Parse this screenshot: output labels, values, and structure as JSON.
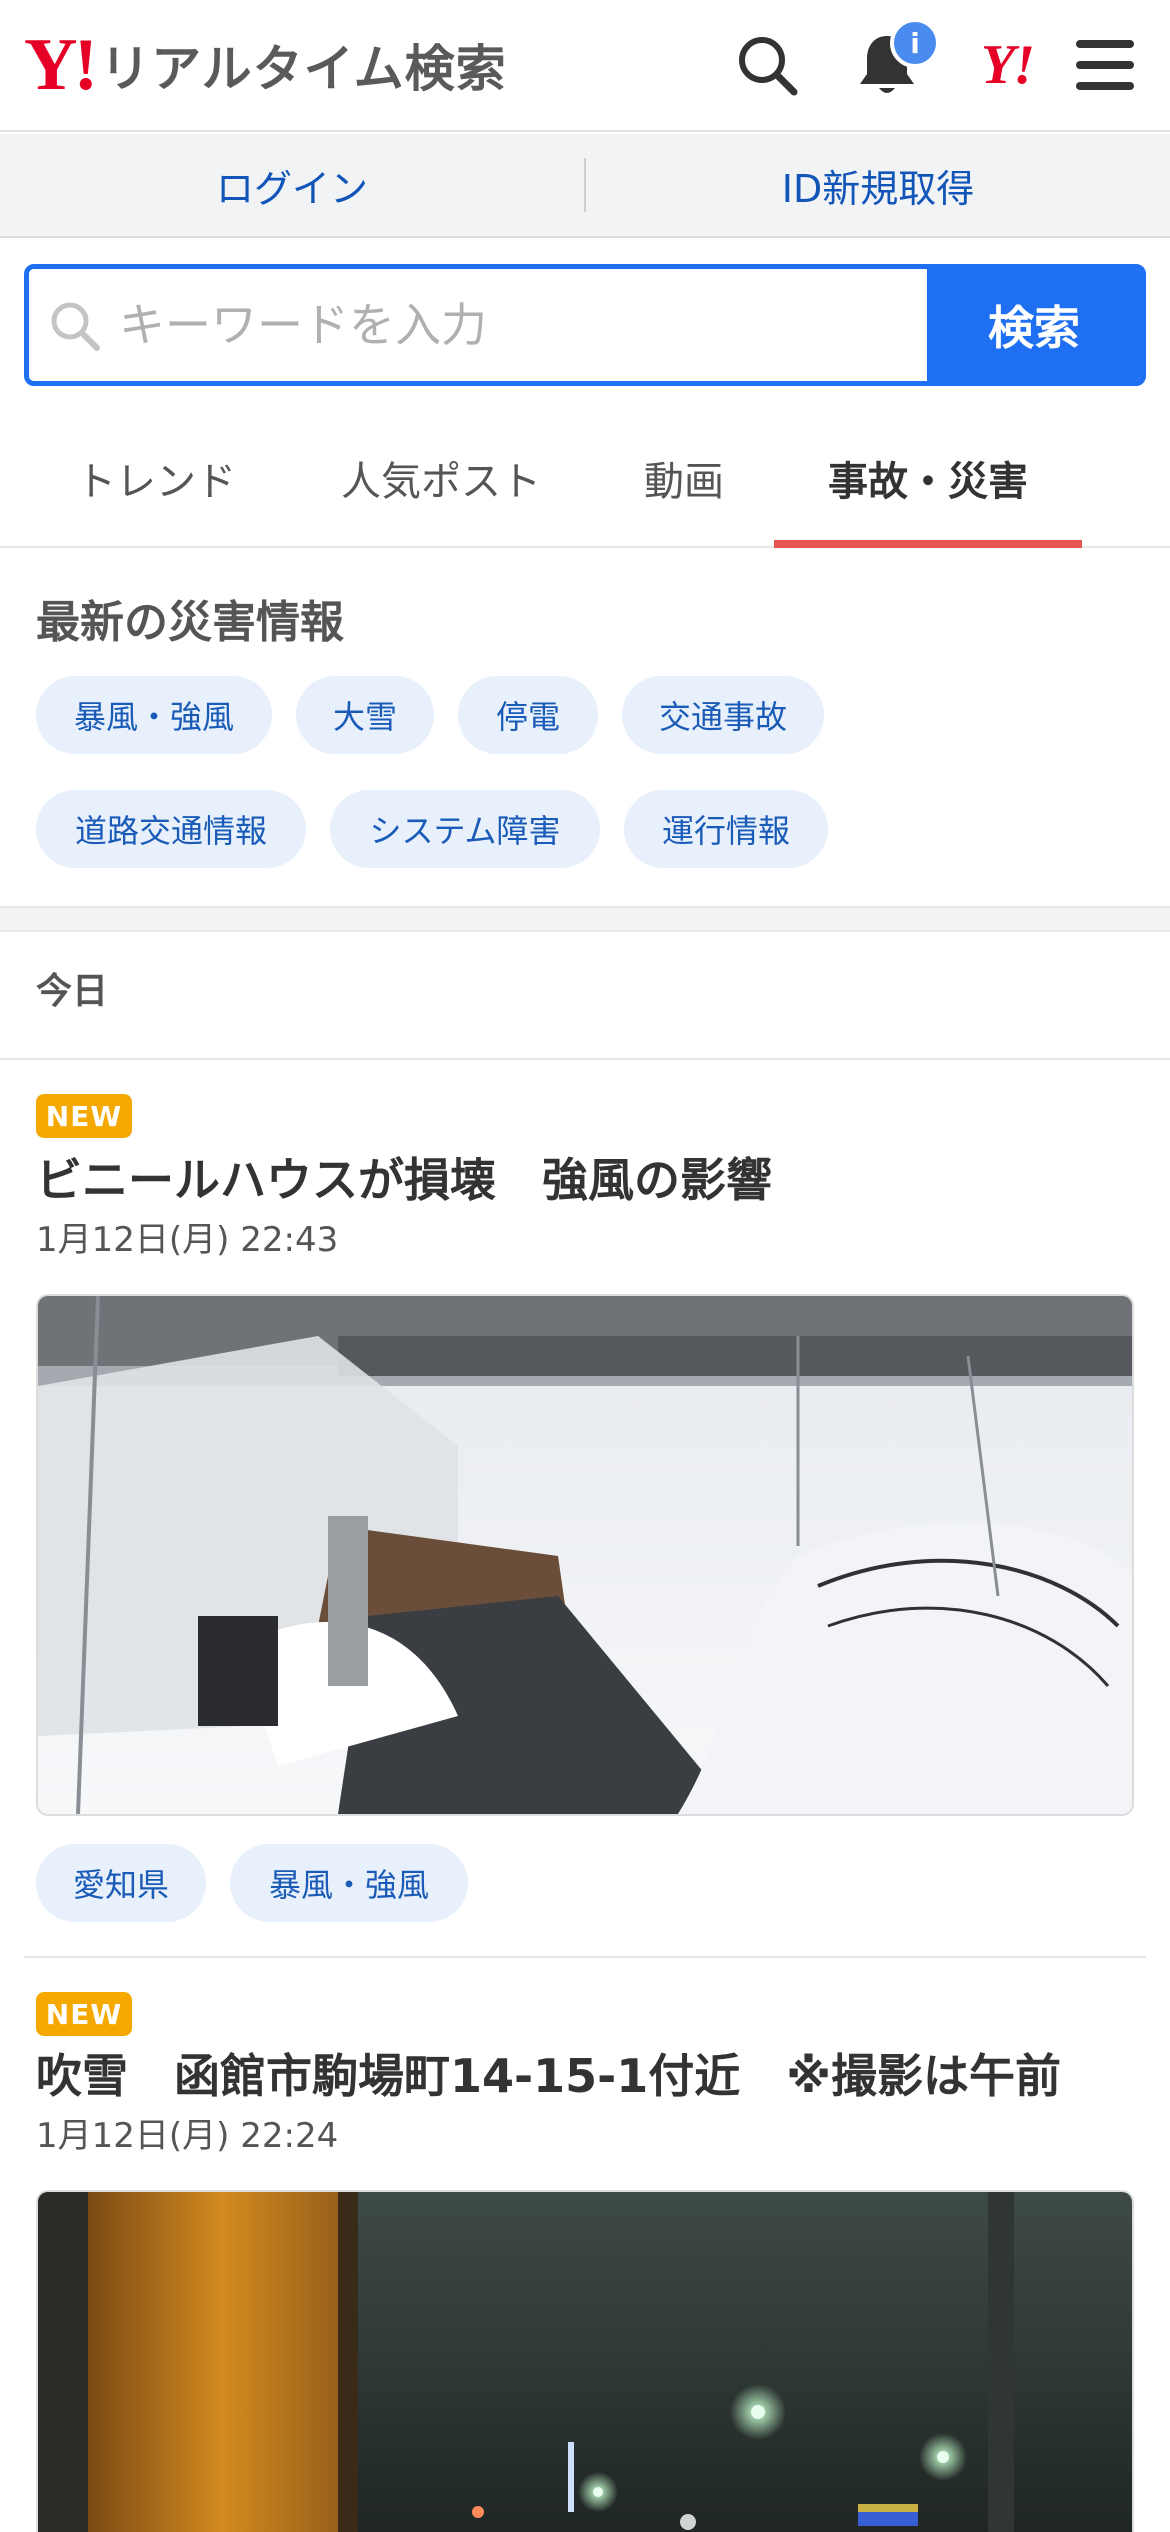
{
  "header": {
    "logo_mark": "Y!",
    "logo_text": "リアルタイム検索",
    "notification_badge": "i",
    "yahoo_mark": "Y!"
  },
  "account": {
    "login": "ログイン",
    "signup": "ID新規取得"
  },
  "search": {
    "placeholder": "キーワードを入力",
    "button": "検索"
  },
  "tabs": [
    "トレンド",
    "人気ポスト",
    "動画",
    "事故・災害"
  ],
  "active_tab": "事故・災害",
  "disaster": {
    "title": "最新の災害情報",
    "chips": [
      "暴風・強風",
      "大雪",
      "停電",
      "交通事故",
      "道路交通情報",
      "システム障害",
      "運行情報"
    ]
  },
  "day_label": "今日",
  "posts": [
    {
      "badge": "NEW",
      "title": "ビニールハウスが損壊　強風の影響",
      "date": "1月12日(月) 22:43",
      "tags": [
        "愛知県",
        "暴風・強風"
      ]
    },
    {
      "badge": "NEW",
      "title": "吹雪　函館市駒場町14-15-1付近　※撮影は午前",
      "date": "1月12日(月) 22:24"
    }
  ],
  "colors": {
    "brand_red": "#e60026",
    "accent_blue": "#1e6ff1",
    "link_blue": "#1155b8",
    "chip_bg": "#e8f0fc",
    "new_badge": "#f5a800",
    "active_tab_underline": "#e8574f"
  }
}
